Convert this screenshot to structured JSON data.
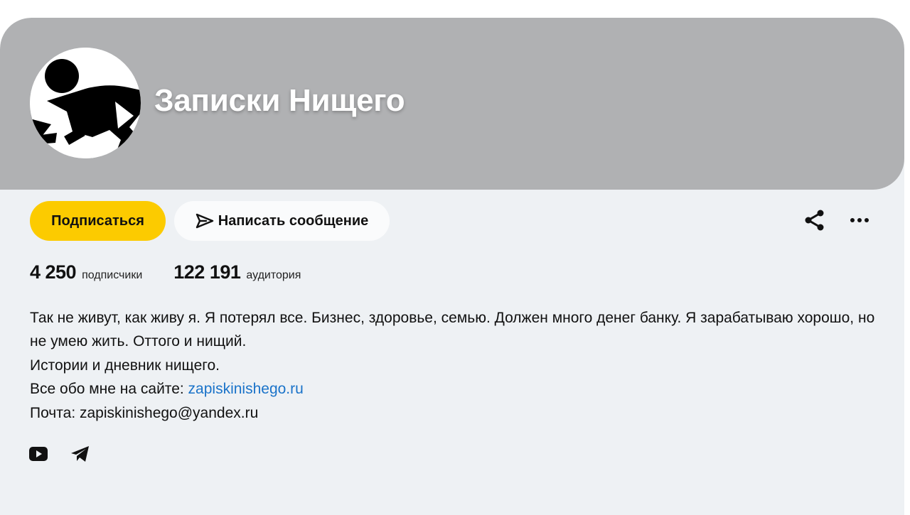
{
  "channel": {
    "title": "Записки Нищего",
    "avatar_icon": "person-bending-icon"
  },
  "actions": {
    "subscribe_label": "Подписаться",
    "message_label": "Написать сообщение",
    "message_icon": "send-icon",
    "share_icon": "share-icon",
    "more_icon": "more-icon"
  },
  "stats": {
    "subscribers_value": "4 250",
    "subscribers_label": "подписчики",
    "audience_value": "122 191",
    "audience_label": "аудитория"
  },
  "description": {
    "line1": "Так не живут, как живу я. Я потерял все. Бизнес, здоровье, семью. Должен много денег банку. Я зарабатываю хорошо, но не умею жить. Оттого и нищий.",
    "line2": "Истории и дневник нищего.",
    "line3_prefix": "Все обо мне на сайте: ",
    "line3_link": "zapiskinishego.ru",
    "line4": "Почта: zapiskinishego@yandex.ru"
  },
  "social": {
    "youtube_icon": "youtube-icon",
    "telegram_icon": "telegram-icon"
  },
  "colors": {
    "banner": "#b0b1b3",
    "card": "#eef1f4",
    "subscribe_button": "#fccb00",
    "link": "#1a73c9"
  }
}
